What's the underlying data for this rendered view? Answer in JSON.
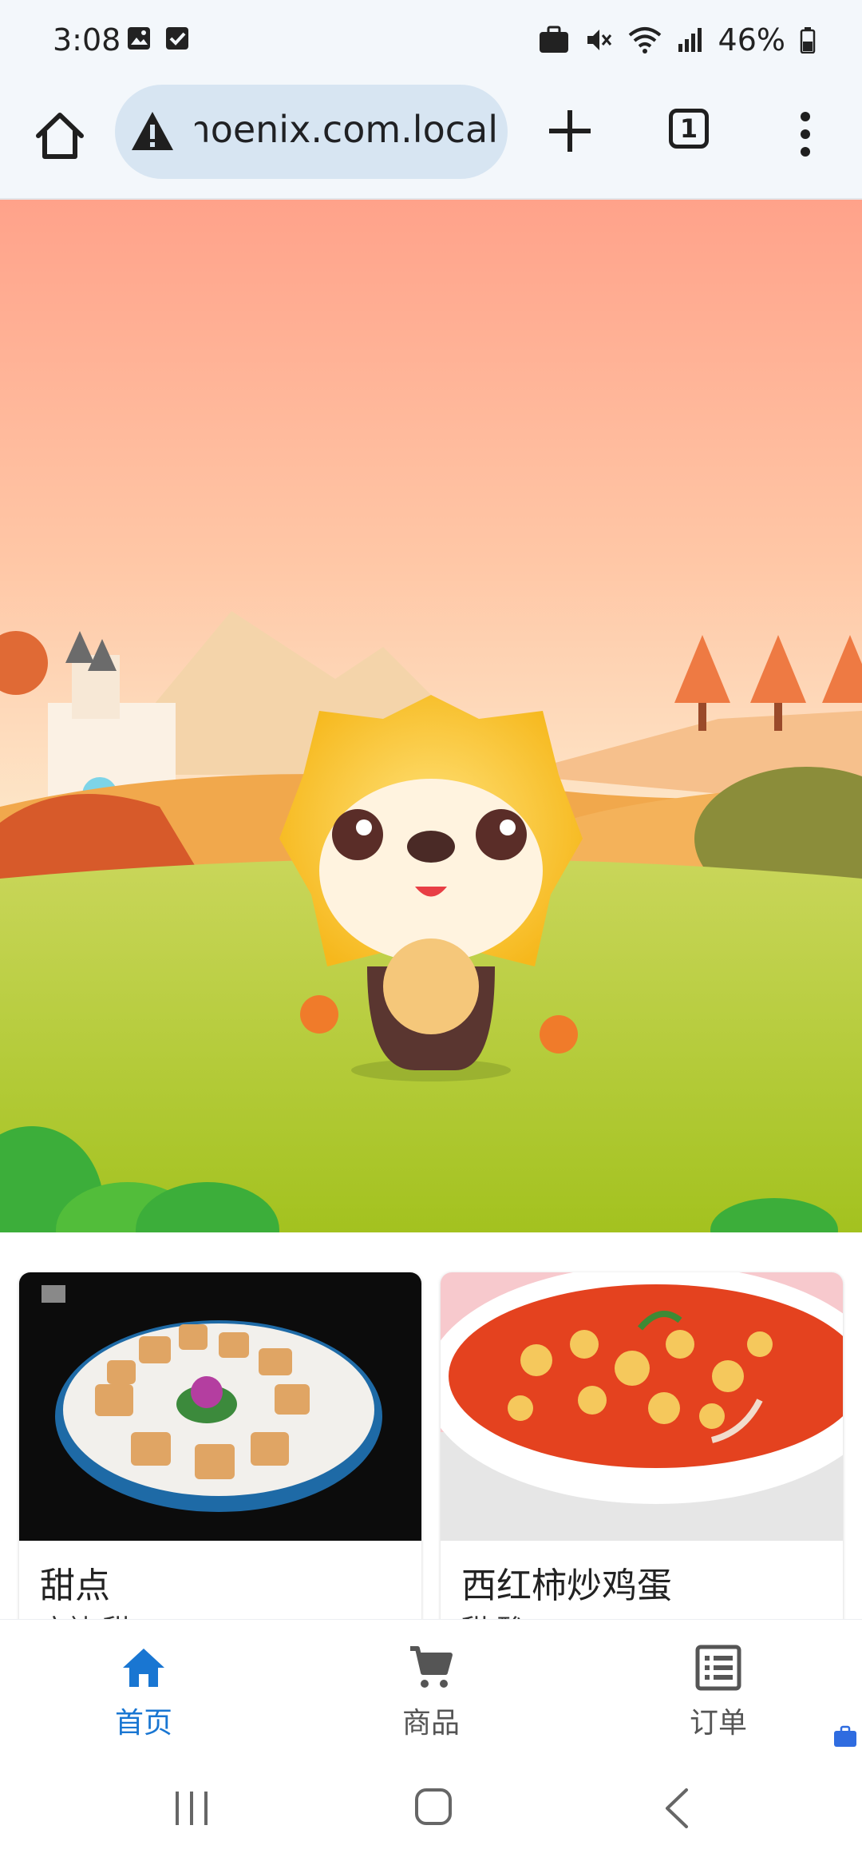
{
  "status_bar": {
    "time": "3:08",
    "battery": "46%",
    "icons": [
      "image-icon",
      "checkbox-icon",
      "briefcase-icon",
      "mute-icon",
      "wifi-icon",
      "signal-icon",
      "battery-icon"
    ]
  },
  "browser": {
    "url": "phoenix.com.local",
    "tab_count": "1"
  },
  "products": [
    {
      "title": "甜点",
      "subtitle": "麻辣,甜"
    },
    {
      "title": "西红柿炒鸡蛋",
      "subtitle": "甜,酸"
    }
  ],
  "bottom_nav": {
    "items": [
      {
        "label": "首页",
        "icon": "home-icon",
        "active": true
      },
      {
        "label": "商品",
        "icon": "cart-icon",
        "active": false
      },
      {
        "label": "订单",
        "icon": "list-icon",
        "active": false
      }
    ],
    "active_color": "#1976d2"
  }
}
